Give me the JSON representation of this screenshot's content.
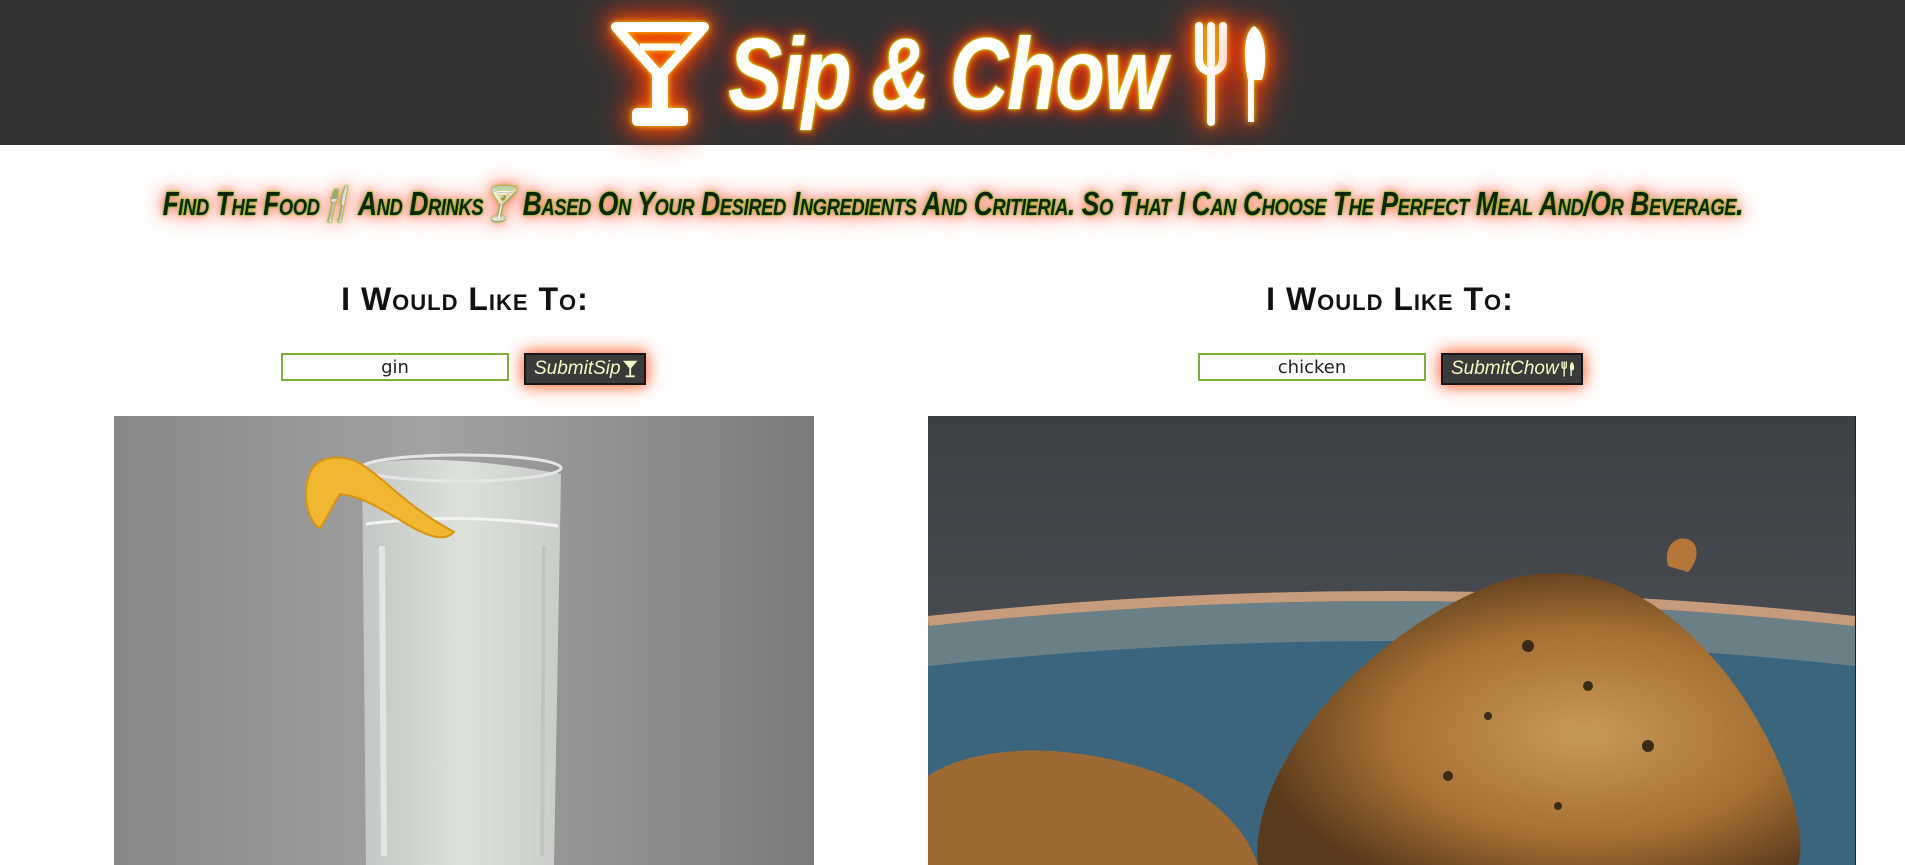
{
  "header": {
    "title": "Sip & Chow",
    "icons": [
      "cocktail-glass-icon",
      "fork-icon",
      "knife-icon"
    ],
    "background": "#333333"
  },
  "tagline": {
    "text": "Find The Food🍴 And Drinks🍸 Based On Your Desired Ingredients And Critieria. So That I Can Choose The Perfect Meal And/Or Beverage."
  },
  "sip": {
    "heading": "I Would Like To:",
    "input_value": "gin",
    "submit_label": "SubmitSip",
    "submit_icon": "cocktail-glass-icon",
    "image": "gin-fizz-glass-with-lemon-peel"
  },
  "chow": {
    "heading": "I Would Like To:",
    "input_value": "chicken",
    "submit_label": "SubmitChow",
    "submit_icon": "fork-knife-icon",
    "image": "roasted-chicken-on-blue-plate"
  },
  "colors": {
    "neon_glow": "#ff4a00",
    "accent_green": "#7db23a",
    "button_bg": "#3a3a3a",
    "button_text": "#f4f9c4"
  }
}
